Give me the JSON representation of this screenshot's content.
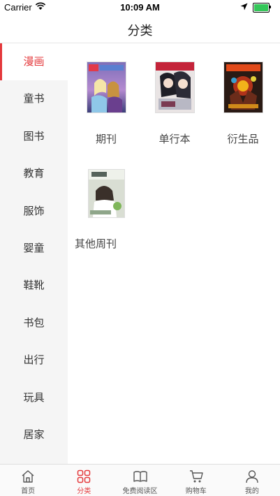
{
  "status_bar": {
    "carrier": "Carrier",
    "time": "10:09 AM",
    "icons": [
      "wifi-icon",
      "location-arrow-icon",
      "battery-icon"
    ]
  },
  "header": {
    "title": "分类"
  },
  "sidebar": {
    "active_index": 0,
    "items": [
      {
        "label": "漫画"
      },
      {
        "label": "童书"
      },
      {
        "label": "图书"
      },
      {
        "label": "教育"
      },
      {
        "label": "服饰"
      },
      {
        "label": "婴童"
      },
      {
        "label": "鞋靴"
      },
      {
        "label": "书包"
      },
      {
        "label": "出行"
      },
      {
        "label": "玩具"
      },
      {
        "label": "居家"
      }
    ]
  },
  "content": {
    "categories": [
      {
        "label": "期刊",
        "cover_title": "童趣·冰雪奇缘"
      },
      {
        "label": "单行本",
        "cover_title": ""
      },
      {
        "label": "衍生品",
        "cover_title": "超能斗士"
      },
      {
        "label": "其他周刊",
        "cover_title": "轻音乐"
      }
    ]
  },
  "tab_bar": {
    "active_index": 1,
    "tabs": [
      {
        "label": "首页",
        "icon": "home-icon"
      },
      {
        "label": "分类",
        "icon": "category-grid-icon"
      },
      {
        "label": "免费阅读区",
        "icon": "open-book-icon"
      },
      {
        "label": "购物车",
        "icon": "cart-icon"
      },
      {
        "label": "我的",
        "icon": "user-icon"
      }
    ]
  },
  "colors": {
    "accent": "#e4393c",
    "sidebar_bg": "#f5f5f5",
    "battery": "#34c759"
  }
}
